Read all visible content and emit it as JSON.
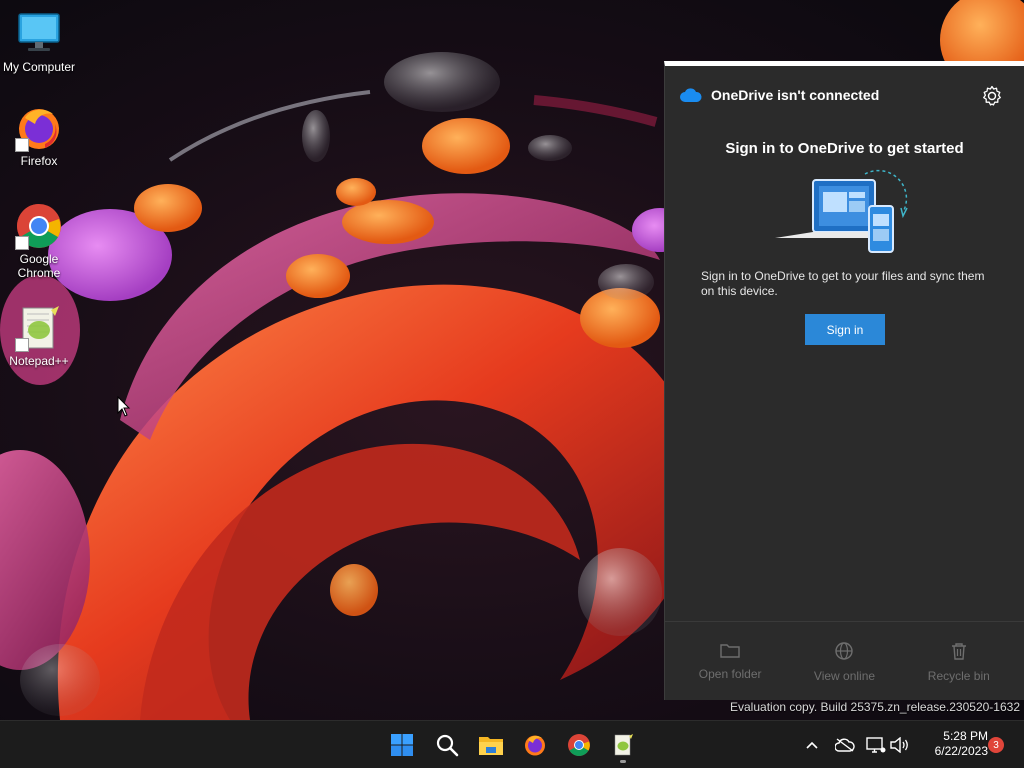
{
  "desktop": {
    "icons": [
      {
        "label": "My Computer"
      },
      {
        "label": "Firefox"
      },
      {
        "label": "Google Chrome"
      },
      {
        "label": "Notepad++"
      }
    ]
  },
  "onedrive": {
    "title": "OneDrive isn't connected",
    "heading": "Sign in to OneDrive to get started",
    "description": "Sign in to OneDrive to get to your files and sync them on this device.",
    "signin_label": "Sign in",
    "actions": [
      {
        "label": "Open folder",
        "icon": "folder-icon"
      },
      {
        "label": "View online",
        "icon": "globe-icon"
      },
      {
        "label": "Recycle bin",
        "icon": "trash-icon"
      }
    ],
    "accent": "#2b88d8"
  },
  "watermark": "Evaluation copy. Build 25375.zn_release.230520-1632",
  "taskbar": {
    "apps": [
      {
        "name": "start",
        "icon": "windows-logo-icon"
      },
      {
        "name": "search",
        "icon": "search-icon"
      },
      {
        "name": "file-explorer",
        "icon": "folder-icon"
      },
      {
        "name": "firefox",
        "icon": "firefox-icon"
      },
      {
        "name": "chrome",
        "icon": "chrome-icon"
      },
      {
        "name": "notepad-plus-plus",
        "icon": "notepad-icon"
      }
    ],
    "tray": [
      "chevron-up-icon",
      "onedrive-offline-icon",
      "network-icon",
      "volume-icon"
    ],
    "clock": {
      "time": "5:28 PM",
      "date": "6/22/2023"
    },
    "notification_count": "3"
  }
}
